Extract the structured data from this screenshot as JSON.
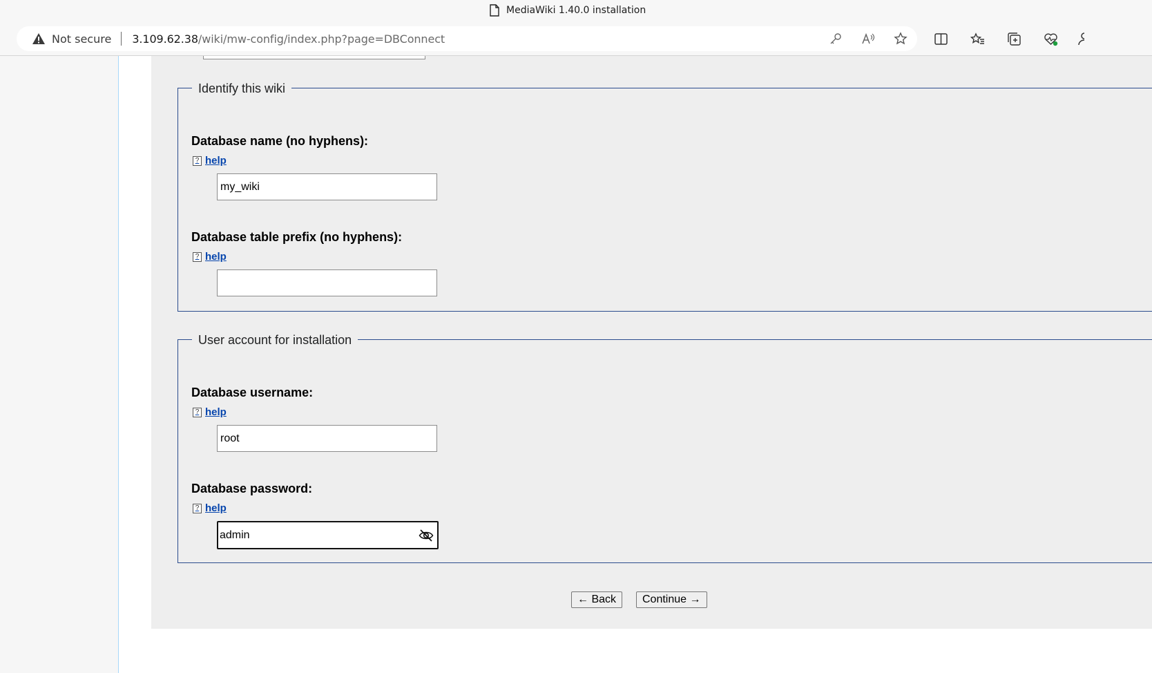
{
  "browser": {
    "tab_title": "MediaWiki 1.40.0 installation",
    "security_label": "Not secure",
    "url_host": "3.109.62.38",
    "url_path": "/wiki/mw-config/index.php?page=DBConnect"
  },
  "sections": {
    "identify": {
      "legend": "Identify this wiki",
      "db_name_label": "Database name (no hyphens):",
      "db_name_help": "help",
      "db_name_value": "my_wiki",
      "prefix_label": "Database table prefix (no hyphens):",
      "prefix_help": "help",
      "prefix_value": ""
    },
    "account": {
      "legend": "User account for installation",
      "username_label": "Database username:",
      "username_help": "help",
      "username_value": "root",
      "password_label": "Database password:",
      "password_help": "help",
      "password_value": "admin"
    }
  },
  "buttons": {
    "back": "← Back",
    "continue": "Continue →"
  },
  "icons": {
    "help": "?",
    "warning": "warning-triangle-icon",
    "password_toggle": "eye-slash-icon"
  },
  "colors": {
    "link": "#0645ad",
    "fieldset_border": "#2a4b8d",
    "form_bg": "#eeeeee"
  }
}
